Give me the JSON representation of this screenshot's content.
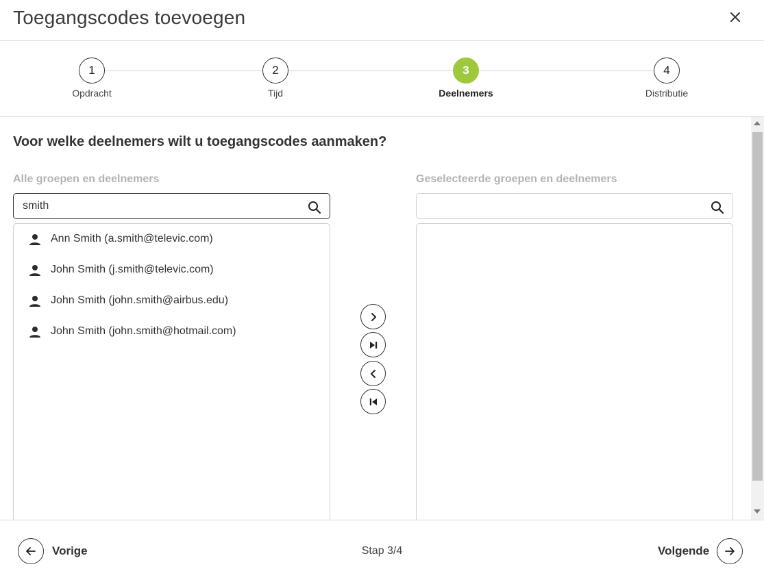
{
  "dialog": {
    "title": "Toegangscodes toevoegen"
  },
  "stepper": {
    "steps": [
      {
        "number": "1",
        "label": "Opdracht"
      },
      {
        "number": "2",
        "label": "Tijd"
      },
      {
        "number": "3",
        "label": "Deelnemers"
      },
      {
        "number": "4",
        "label": "Distributie"
      }
    ],
    "active_step": 3,
    "active_color": "#9fc93c"
  },
  "main": {
    "question": "Voor welke deelnemers wilt u toegangscodes aanmaken?",
    "available": {
      "label": "Alle groepen en deelnemers",
      "search_value": "smith",
      "items": [
        {
          "label": "Ann Smith (a.smith@televic.com)"
        },
        {
          "label": "John Smith (j.smith@televic.com)"
        },
        {
          "label": "John Smith (john.smith@airbus.edu)"
        },
        {
          "label": "John Smith (john.smith@hotmail.com)"
        }
      ]
    },
    "selected": {
      "label": "Geselecteerde groepen en deelnemers",
      "search_value": "",
      "items": []
    }
  },
  "footer": {
    "prev_label": "Vorige",
    "next_label": "Volgende",
    "step_indicator": "Stap 3/4"
  }
}
